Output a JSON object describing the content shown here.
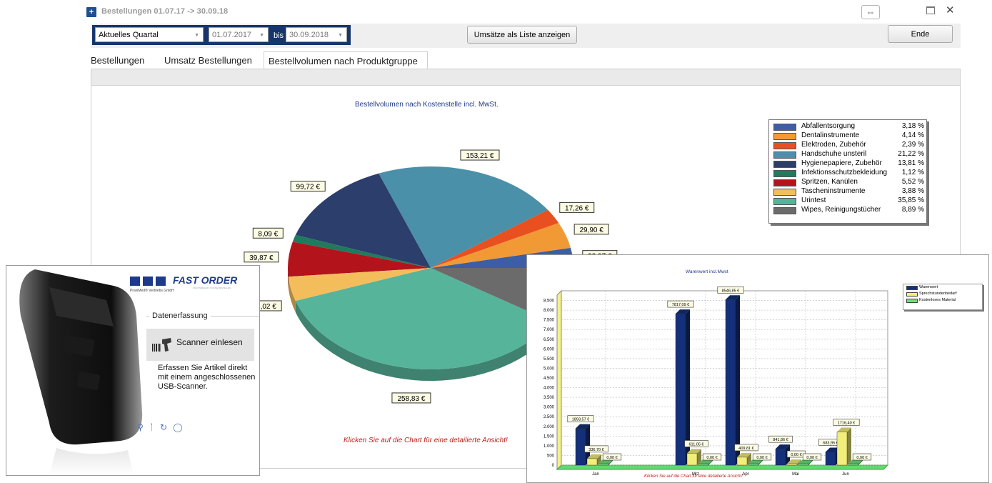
{
  "window": {
    "title": "Bestellungen 01.07.17 -> 30.09.18",
    "resize_icon": "⇔",
    "maximize_icon": "maximize-icon",
    "close_icon": "✕"
  },
  "toolbar": {
    "period_select": "Aktuelles Quartal",
    "date_from": "01.07.2017",
    "bis_label": "bis",
    "date_to": "30.09.2018",
    "list_button": "Umsätze als Liste anzeigen",
    "end_button": "Ende"
  },
  "tabs": [
    {
      "label": "Bestellungen"
    },
    {
      "label": "Umsatz Bestellungen"
    },
    {
      "label": "Bestellvolumen nach Produktgruppe"
    }
  ],
  "active_tab": 2,
  "pie_panel": {
    "title": "Bestellvolumen nach Kostenstelle incl. MwSt.",
    "hint": "Klicken Sie auf die Chart für eine detailierte Ansicht!"
  },
  "scanner_panel": {
    "brand": "FAST ORDER",
    "tagline": "PRAXISBEDARF ONLINE BESTELLEN",
    "company": "PraxiMed® Vertriebs GmbH",
    "section_label": "Datenerfassung",
    "button_label": "Scanner einlesen",
    "description": "Erfassen Sie Artikel direkt mit einem angeschlossenen USB-Scanner.",
    "tool_icons": [
      "search-icon",
      "wrench-icon",
      "refresh-icon",
      "chat-icon"
    ]
  },
  "bar_panel": {
    "hint": "Klicken Sie auf die Chart für eine detailierte Ansicht!"
  },
  "chart_data": [
    {
      "type": "pie",
      "title": "Bestellvolumen nach Kostenstelle incl. MwSt.",
      "style": "3d",
      "legend_position": "right",
      "slices": [
        {
          "label": "Abfallentsorgung",
          "percent": "3,18 %",
          "value": 3.18,
          "value_label": "22,97 €",
          "color": "#3d5ea6"
        },
        {
          "label": "Dentalinstrumente",
          "percent": "4,14 %",
          "value": 4.14,
          "value_label": "29,90 €",
          "color": "#f19a35"
        },
        {
          "label": "Elektroden, Zubehör",
          "percent": "2,39 %",
          "value": 2.39,
          "value_label": "17,26 €",
          "color": "#e9501f"
        },
        {
          "label": "Handschuhe unsteril",
          "percent": "21,22 %",
          "value": 21.22,
          "value_label": "153,21 €",
          "color": "#4a90a8"
        },
        {
          "label": "Hygienepapiere, Zubehör",
          "percent": "13,81 %",
          "value": 13.81,
          "value_label": "99,72 €",
          "color": "#2c3e6b"
        },
        {
          "label": "Infektionsschutzbekleidung",
          "percent": "1,12 %",
          "value": 1.12,
          "value_label": "8,09 €",
          "color": "#1f7a5e"
        },
        {
          "label": "Spritzen, Kanülen",
          "percent": "5,52 %",
          "value": 5.52,
          "value_label": "39,87 €",
          "color": "#b3141c"
        },
        {
          "label": "Tascheninstrumente",
          "percent": "3,88 %",
          "value": 3.88,
          "value_label": "28,02 €",
          "color": "#f4bd5c"
        },
        {
          "label": "Urintest",
          "percent": "35,85 %",
          "value": 35.85,
          "value_label": "258,83 €",
          "color": "#56b49a"
        },
        {
          "label": "Wipes, Reinigungstücher",
          "percent": "8,89 %",
          "value": 8.89,
          "value_label": "",
          "color": "#6b6b6b"
        }
      ]
    },
    {
      "type": "bar",
      "title": "Warenwert incl.Mwst",
      "style": "3d",
      "legend_position": "top-right",
      "categories": [
        "Jan",
        "Mrz",
        "Apr",
        "Mai",
        "Jun"
      ],
      "y_ticks": [
        "0",
        "500",
        "1.000",
        "1.500",
        "2.000",
        "2.500",
        "3.000",
        "3.500",
        "4.000",
        "4.500",
        "5.000",
        "5.500",
        "6.000",
        "6.500",
        "7.000",
        "7.500",
        "8.000",
        "8.500"
      ],
      "ylim": [
        0,
        9000
      ],
      "series": [
        {
          "name": "Warenwert",
          "color": "#14307a",
          "values": [
            1893.57,
            7817.09,
            8546.85,
            841.86,
            683.95
          ],
          "labels": [
            "1893,57 €",
            "7817,09 €",
            "8546,85 €",
            "841,86 €",
            "683,95 €"
          ]
        },
        {
          "name": "Sprechstundenbedarf",
          "color": "#f2ee7a",
          "values": [
            336.7,
            611.05,
            409.81,
            0.0,
            1716.4
          ],
          "labels": [
            "336,70 €",
            "611,05 €",
            "409,81 €",
            "0,00 €",
            "1716,40 €"
          ]
        },
        {
          "name": "Kostenloses Material",
          "color": "#6ee07a",
          "values": [
            0.0,
            0.0,
            0.0,
            0.0,
            0.0
          ],
          "labels": [
            "0,00 €",
            "0,00 €",
            "0,00 €",
            "0,00 €",
            "0,00 €"
          ]
        }
      ]
    }
  ]
}
